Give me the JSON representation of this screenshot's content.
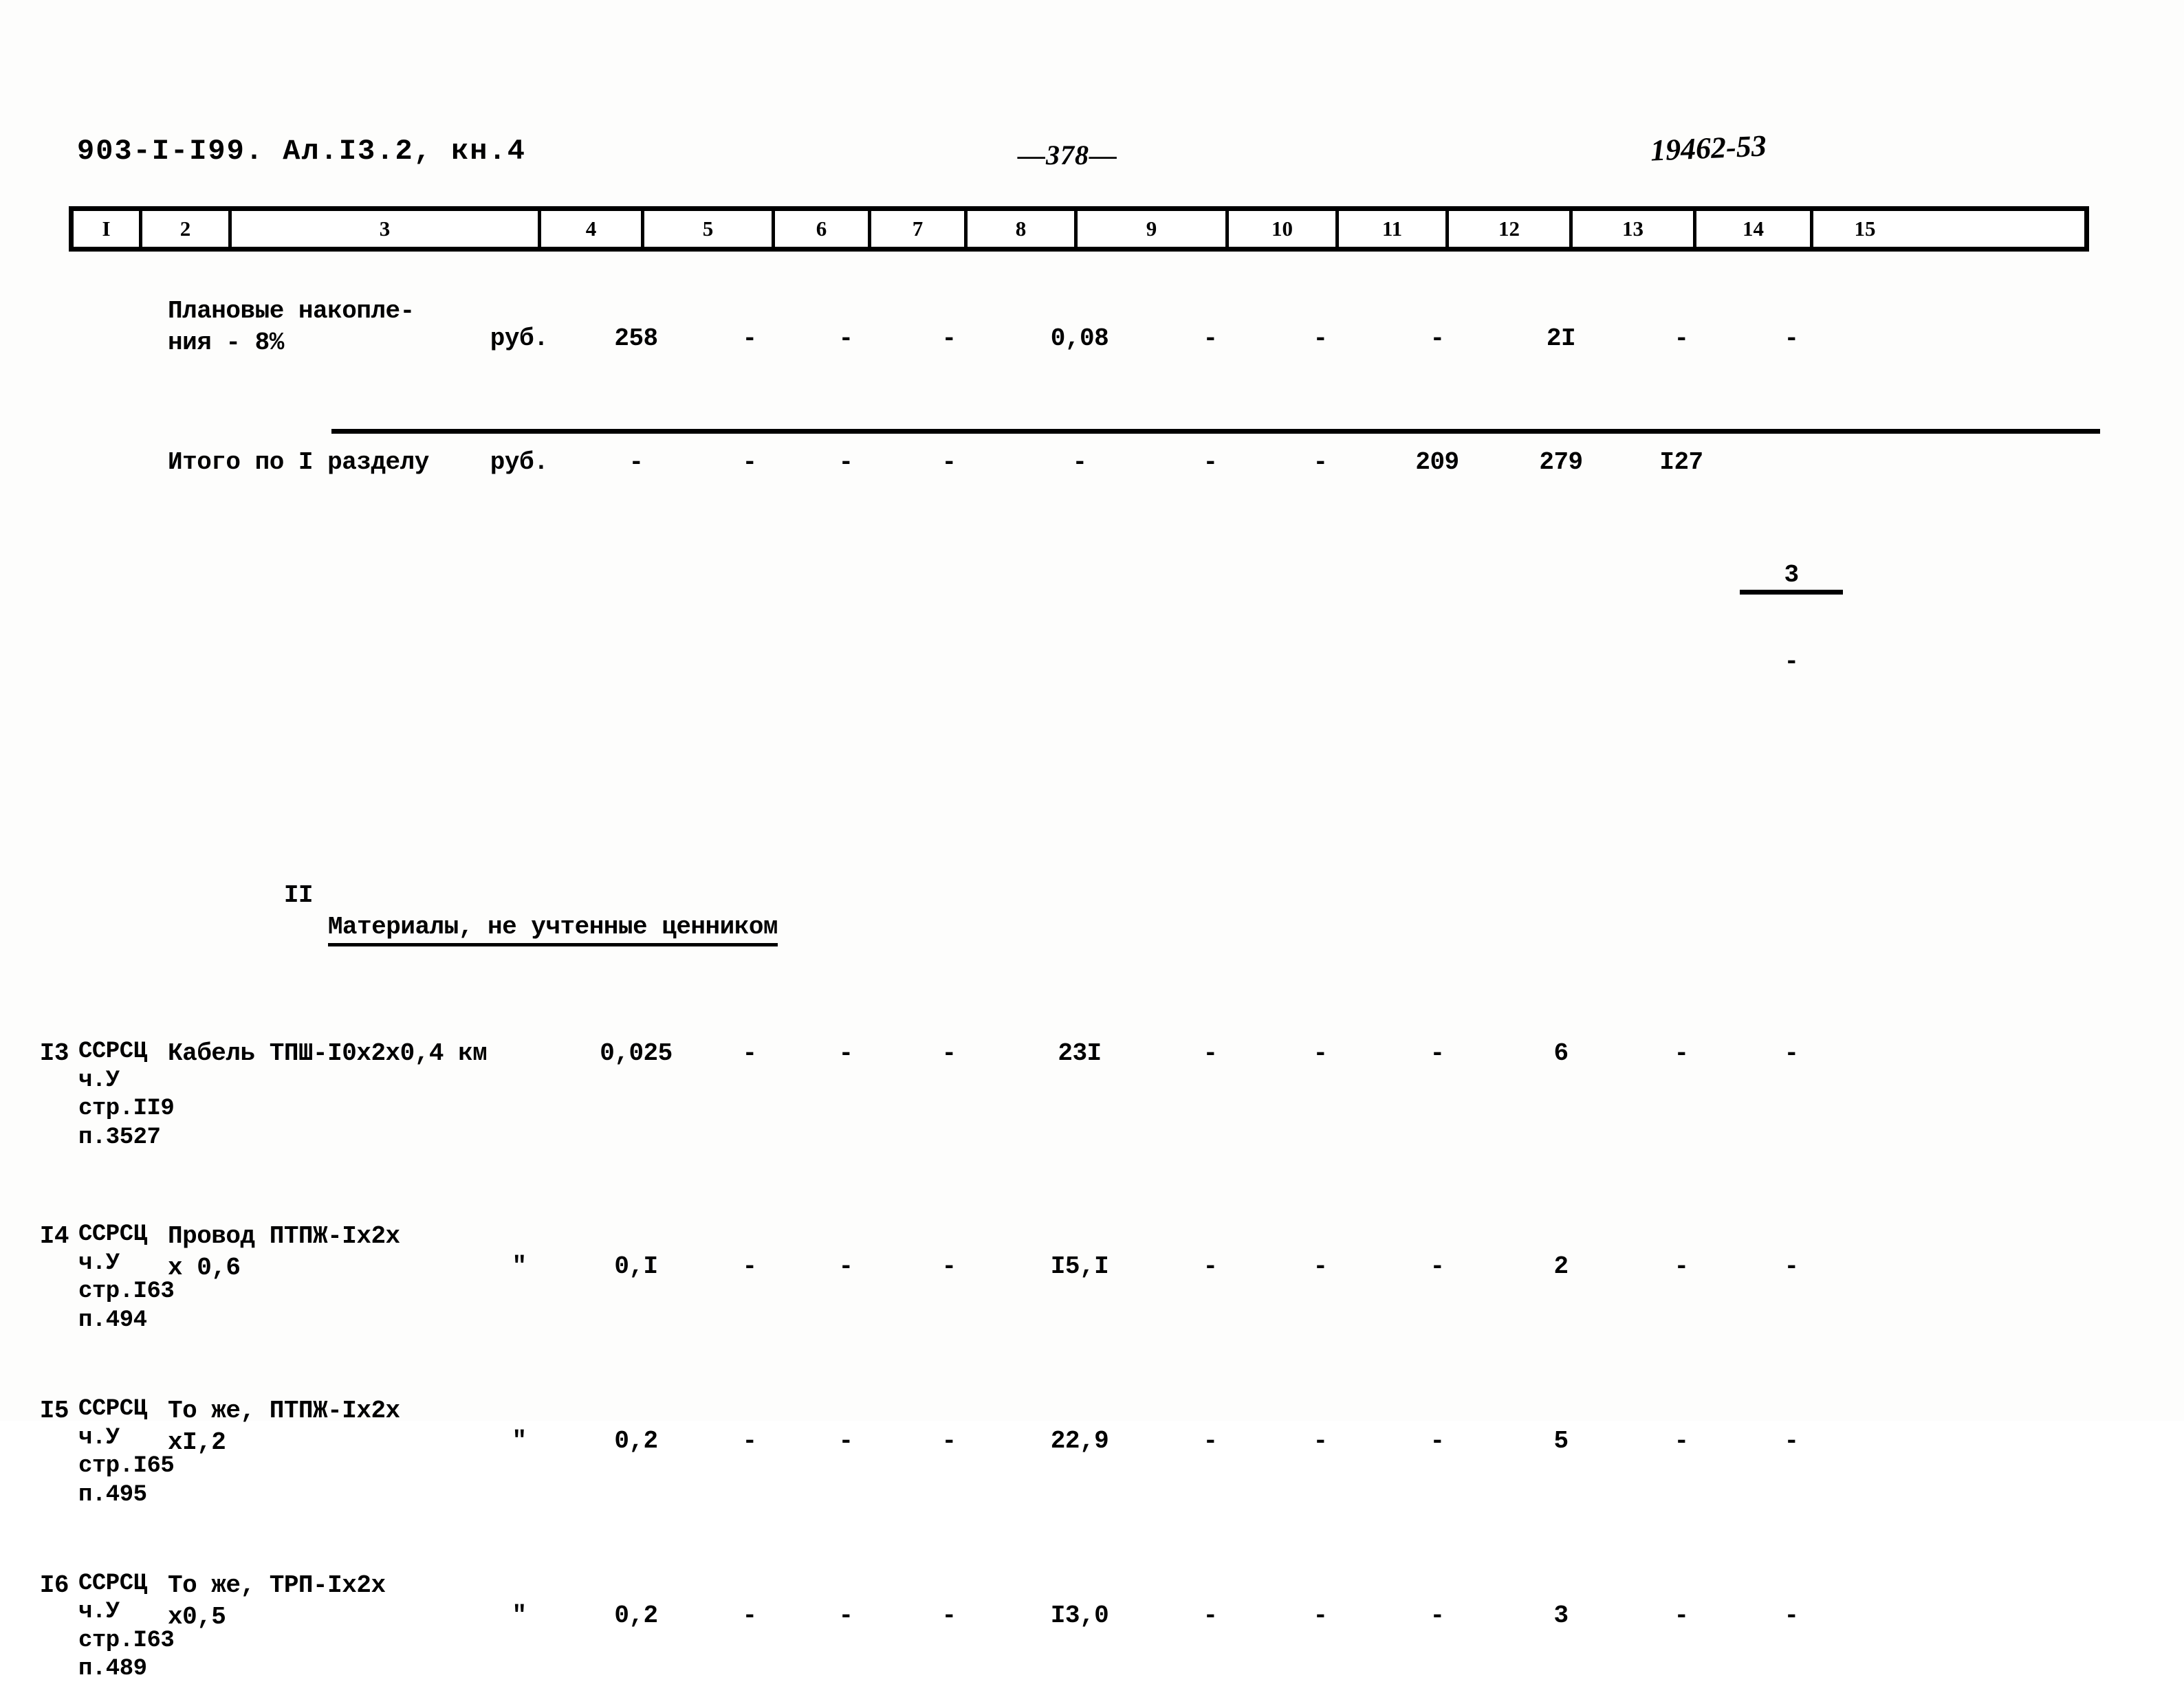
{
  "header": {
    "doc_code": "903-I-I99. Ал.I3.2, кн.4",
    "page_number": "—378—",
    "stamp": "19462-53"
  },
  "table": {
    "column_numbers": [
      "I",
      "2",
      "3",
      "4",
      "5",
      "6",
      "7",
      "8",
      "9",
      "10",
      "11",
      "12",
      "13",
      "14",
      "15"
    ],
    "rows": [
      {
        "num": "",
        "ref": "",
        "name": "Плановые накопле-\nния - 8%",
        "unit": "руб.",
        "c5": "258",
        "c6": "-",
        "c7": "-",
        "c8": "-",
        "c9": "0,08",
        "c10": "-",
        "c11": "-",
        "c12": "-",
        "c13": "2I",
        "c14": "-",
        "c15": "-"
      },
      {
        "num": "",
        "ref": "",
        "name": "Итого по I разделу",
        "unit": "руб.",
        "c5": "-",
        "c6": "-",
        "c7": "-",
        "c8": "-",
        "c9": "-",
        "c10": "-",
        "c11": "-",
        "c12": "209",
        "c13": "279",
        "c14": "I27",
        "c15_num": "3",
        "c15_den": "-"
      },
      {
        "num": "I3",
        "ref": "ССРСЦ\nч.У\nстр.II9\nп.3527",
        "name": "Кабель ТПШ-I0x2x0,4 км",
        "unit": "",
        "c5": "0,025",
        "c6": "-",
        "c7": "-",
        "c8": "-",
        "c9": "23I",
        "c10": "-",
        "c11": "-",
        "c12": "-",
        "c13": "6",
        "c14": "-",
        "c15": "-"
      },
      {
        "num": "I4",
        "ref": "ССРСЦ\nч.У\nстр.I63\nп.494",
        "name": "Провод ПТПЖ-Iх2х\nх 0,6",
        "unit": "\"",
        "c5": "0,I",
        "c6": "-",
        "c7": "-",
        "c8": "-",
        "c9": "I5,I",
        "c10": "-",
        "c11": "-",
        "c12": "-",
        "c13": "2",
        "c14": "-",
        "c15": "-"
      },
      {
        "num": "I5",
        "ref": "ССРСЦ\nч.У\nстр.I65\nп.495",
        "name": "То же, ПТПЖ-Iх2х\nхI,2",
        "unit": "\"",
        "c5": "0,2",
        "c6": "-",
        "c7": "-",
        "c8": "-",
        "c9": "22,9",
        "c10": "-",
        "c11": "-",
        "c12": "-",
        "c13": "5",
        "c14": "-",
        "c15": "-"
      },
      {
        "num": "I6",
        "ref": "ССРСЦ\nч.У\nстр.I63\nп.489",
        "name": "То же, ТРП-Iх2х\nх0,5",
        "unit": "\"",
        "c5": "0,2",
        "c6": "-",
        "c7": "-",
        "c8": "-",
        "c9": "I3,0",
        "c10": "-",
        "c11": "-",
        "c12": "-",
        "c13": "3",
        "c14": "-",
        "c15": "-"
      }
    ],
    "section": {
      "numeral": "II",
      "title": "Материалы, не учтенные ценником"
    }
  }
}
